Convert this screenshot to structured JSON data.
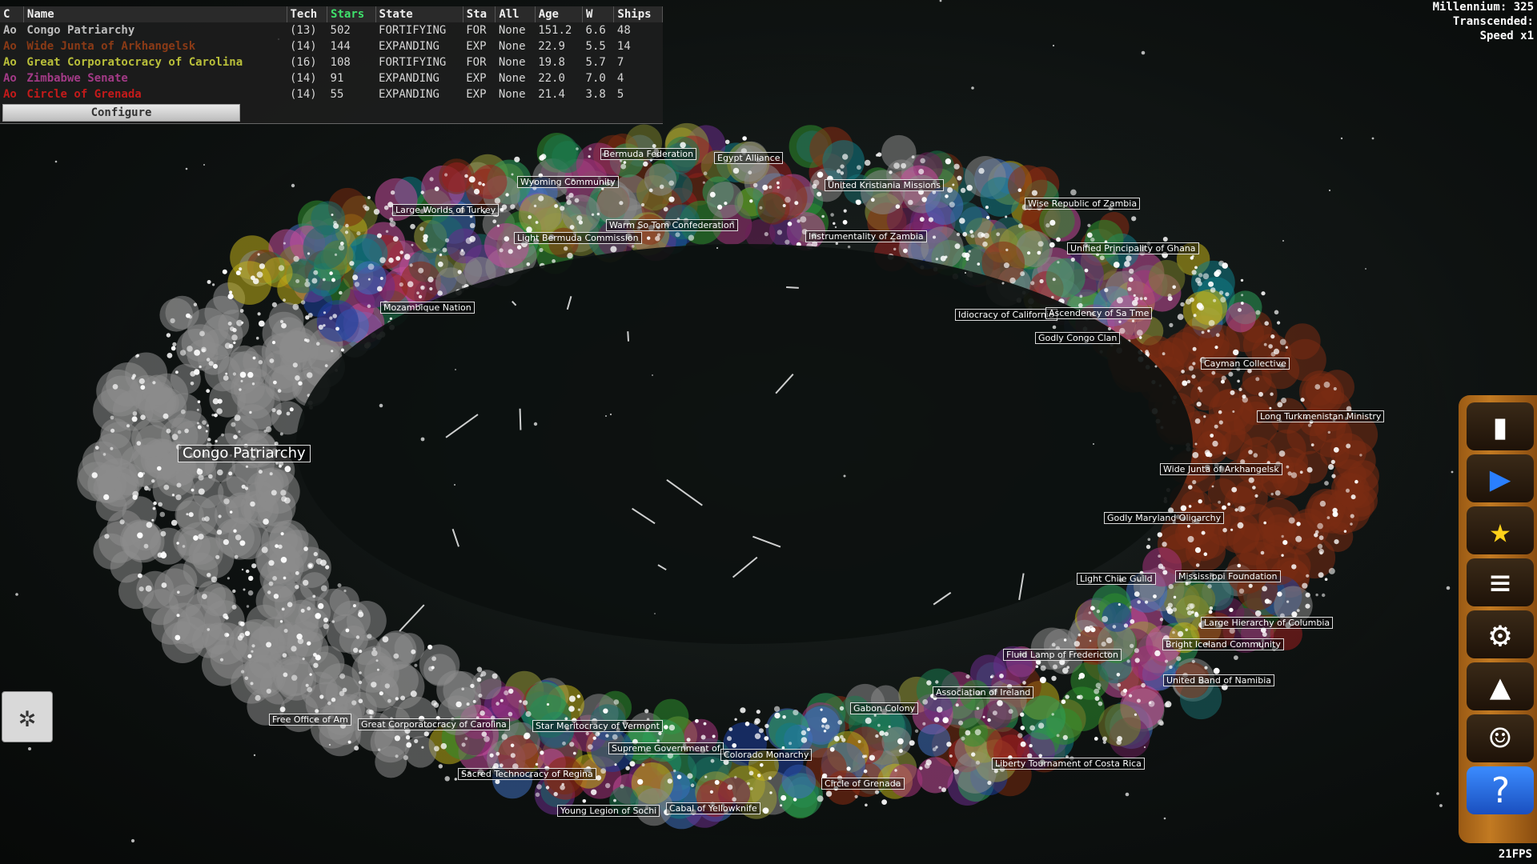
{
  "hud": {
    "millennium": "Millennium: 325",
    "transcended": "Transcended:",
    "speed": "Speed x1",
    "fps": "21FPS"
  },
  "empire_table": {
    "columns": [
      "C",
      "Name",
      "Tech",
      "Stars",
      "State",
      "Sta",
      "All",
      "Age",
      "W",
      "Ships"
    ],
    "sorted_column": "Stars",
    "rows": [
      {
        "c": "Ao",
        "name": "Congo Patriarchy",
        "color": "#bdbdbd",
        "tech": "(13)",
        "stars": "502",
        "state": "FORTIFYING",
        "sta": "FOR",
        "all": "None",
        "age": "151.2",
        "w": "6.6",
        "ships": "48"
      },
      {
        "c": "Ao",
        "name": "Wide Junta of Arkhangelsk",
        "color": "#8a3a16",
        "tech": "(14)",
        "stars": "144",
        "state": "EXPANDING",
        "sta": "EXP",
        "all": "None",
        "age": "22.9",
        "w": "5.5",
        "ships": "14"
      },
      {
        "c": "Ao",
        "name": "Great Corporatocracy of Carolina",
        "color": "#b9bf3a",
        "tech": "(16)",
        "stars": "108",
        "state": "FORTIFYING",
        "sta": "FOR",
        "all": "None",
        "age": "19.8",
        "w": "5.7",
        "ships": "7"
      },
      {
        "c": "Ao",
        "name": "Zimbabwe Senate",
        "color": "#a23a86",
        "tech": "(14)",
        "stars": "91",
        "state": "EXPANDING",
        "sta": "EXP",
        "all": "None",
        "age": "22.0",
        "w": "7.0",
        "ships": "4"
      },
      {
        "c": "Ao",
        "name": "Circle of Grenada",
        "color": "#c41a1a",
        "tech": "(14)",
        "stars": "55",
        "state": "EXPANDING",
        "sta": "EXP",
        "all": "None",
        "age": "21.4",
        "w": "3.8",
        "ships": "5"
      }
    ],
    "configure_label": "Configure"
  },
  "toolbar": {
    "items": [
      {
        "name": "flag-icon",
        "glyph": "▮"
      },
      {
        "name": "fast-forward-icon",
        "glyph": "▶"
      },
      {
        "name": "star-icon",
        "glyph": "★"
      },
      {
        "name": "stats-bars-icon",
        "glyph": "≡"
      },
      {
        "name": "settings-gear-icon",
        "glyph": "⚙"
      },
      {
        "name": "cake-icon",
        "glyph": "▲"
      },
      {
        "name": "people-icon",
        "glyph": "☺"
      },
      {
        "name": "help-icon",
        "glyph": "?"
      }
    ]
  },
  "labels": [
    "Congo Patriarchy",
    "Bermuda Federation",
    "Egypt Alliance",
    "Wyoming Community",
    "Large Worlds of Turkey",
    "Warm So Tom Confederation",
    "Light Bermuda Commission",
    "United Kristiania Missions",
    "Instrumentality of Zambia",
    "Wise Republic of Zambia",
    "Unified Principality of Ghana",
    "Mozambique Nation",
    "Idiocracy of California",
    "Ascendency of Sa Tme",
    "Godly Congo Clan",
    "Cayman Collective",
    "Long Turkmenistan Ministry",
    "Wide Junta of Arkhangelsk",
    "Godly Maryland Oligarchy",
    "Light Chile Guild",
    "Mississippi Foundation",
    "Large Hierarchy of Columbia",
    "Bright Iceland Community",
    "Fluid Lamp of Fredericton",
    "Gabon Colony",
    "Free Office of Am",
    "Great Corporatocracy of Carolina",
    "Star Meritocracy of Vermont",
    "Supreme Government of",
    "Colorado Monarchy",
    "Sacred Technocracy of Regina",
    "Circle of Grenada",
    "Young Legion of Sochi",
    "Cabal of Yellowknife",
    "Liberty Tournament of Costa Rica",
    "United Band of Namibia",
    "Association of Ireland"
  ]
}
